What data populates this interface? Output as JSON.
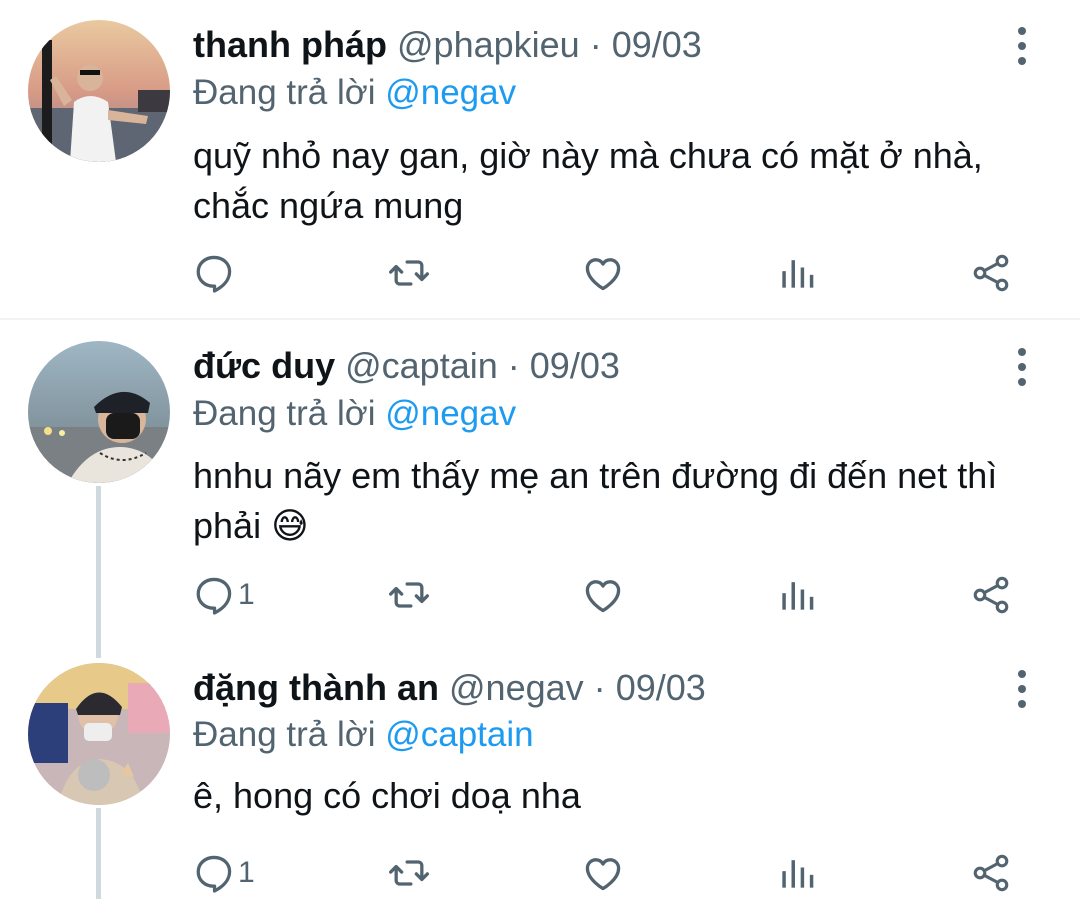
{
  "tweets": [
    {
      "name": "thanh pháp",
      "handle": "@phapkieu",
      "separator": "·",
      "date": "09/03",
      "replying_prefix": "Đang trả lời",
      "replying_to": "@negav",
      "text_line1": "quỹ nhỏ nay gan, giờ này mà chưa có mặt ở nhà,",
      "text_line2": "chắc ngứa mung",
      "reply_count": ""
    },
    {
      "name": "đức duy",
      "handle": "@captain",
      "separator": "·",
      "date": "09/03",
      "replying_prefix": "Đang trả lời",
      "replying_to": "@negav",
      "text_line1": "hnhu nãy em thấy mẹ an trên đường đi đến net thì",
      "text_line2": "phải",
      "emoji": "😅",
      "reply_count": "1"
    },
    {
      "name": "đặng thành an",
      "handle": "@negav",
      "separator": "·",
      "date": "09/03",
      "replying_prefix": "Đang trả lời",
      "replying_to": "@captain",
      "text_line1": "ê, hong có chơi doạ nha",
      "reply_count": "1"
    }
  ],
  "colors": {
    "text": "#0f1419",
    "secondary": "#536471",
    "accent": "#1d9bf0",
    "divider": "#eff3f4",
    "thread_line": "#cfd9de"
  },
  "icons": [
    "reply-icon",
    "retweet-icon",
    "like-icon",
    "analytics-icon",
    "share-icon",
    "more-icon"
  ]
}
